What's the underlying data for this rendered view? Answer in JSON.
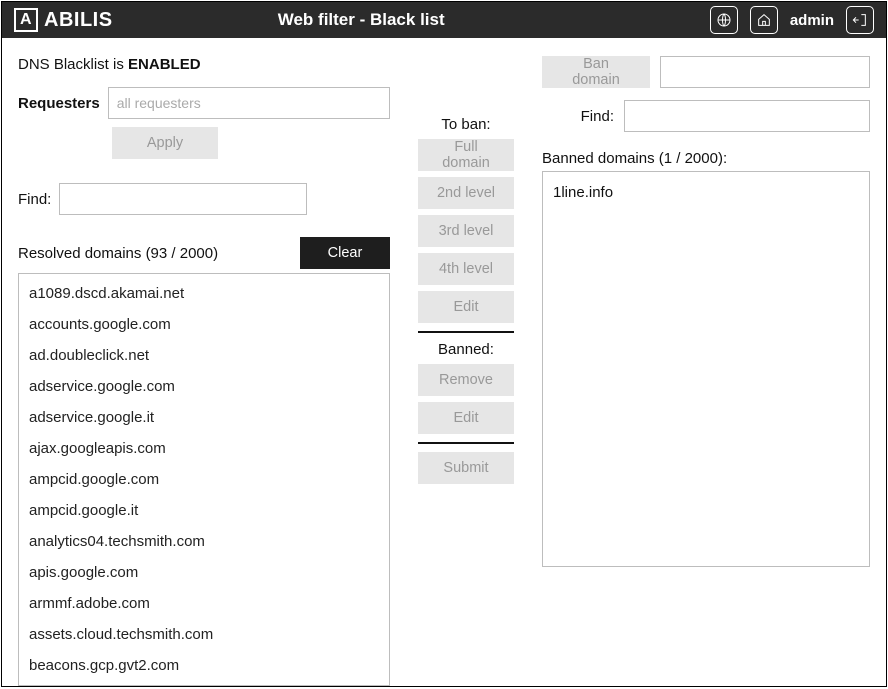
{
  "header": {
    "logo_text": "ABILIS",
    "title": "Web filter - Black list",
    "username": "admin"
  },
  "left": {
    "status_prefix": "DNS Blacklist is ",
    "status_value": "ENABLED",
    "requesters_label": "Requesters",
    "requesters_placeholder": "all requesters",
    "apply": "Apply",
    "find_label": "Find:",
    "resolved_label": "Resolved domains (93 / 2000)",
    "clear": "Clear",
    "domains": [
      "a1089.dscd.akamai.net",
      "accounts.google.com",
      "ad.doubleclick.net",
      "adservice.google.com",
      "adservice.google.it",
      "ajax.googleapis.com",
      "ampcid.google.com",
      "ampcid.google.it",
      "analytics04.techsmith.com",
      "apis.google.com",
      "armmf.adobe.com",
      "assets.cloud.techsmith.com",
      "beacons.gcp.gvt2.com"
    ]
  },
  "mid": {
    "to_ban_label": "To ban:",
    "full_domain": "Full domain",
    "second_level": "2nd level",
    "third_level": "3rd level",
    "fourth_level": "4th level",
    "edit": "Edit",
    "banned_label": "Banned:",
    "remove": "Remove",
    "submit": "Submit"
  },
  "right": {
    "ban_domain": "Ban domain",
    "find_label": "Find:",
    "banned_domains_label": "Banned domains (1 / 2000):",
    "banned": [
      "1line.info"
    ]
  }
}
